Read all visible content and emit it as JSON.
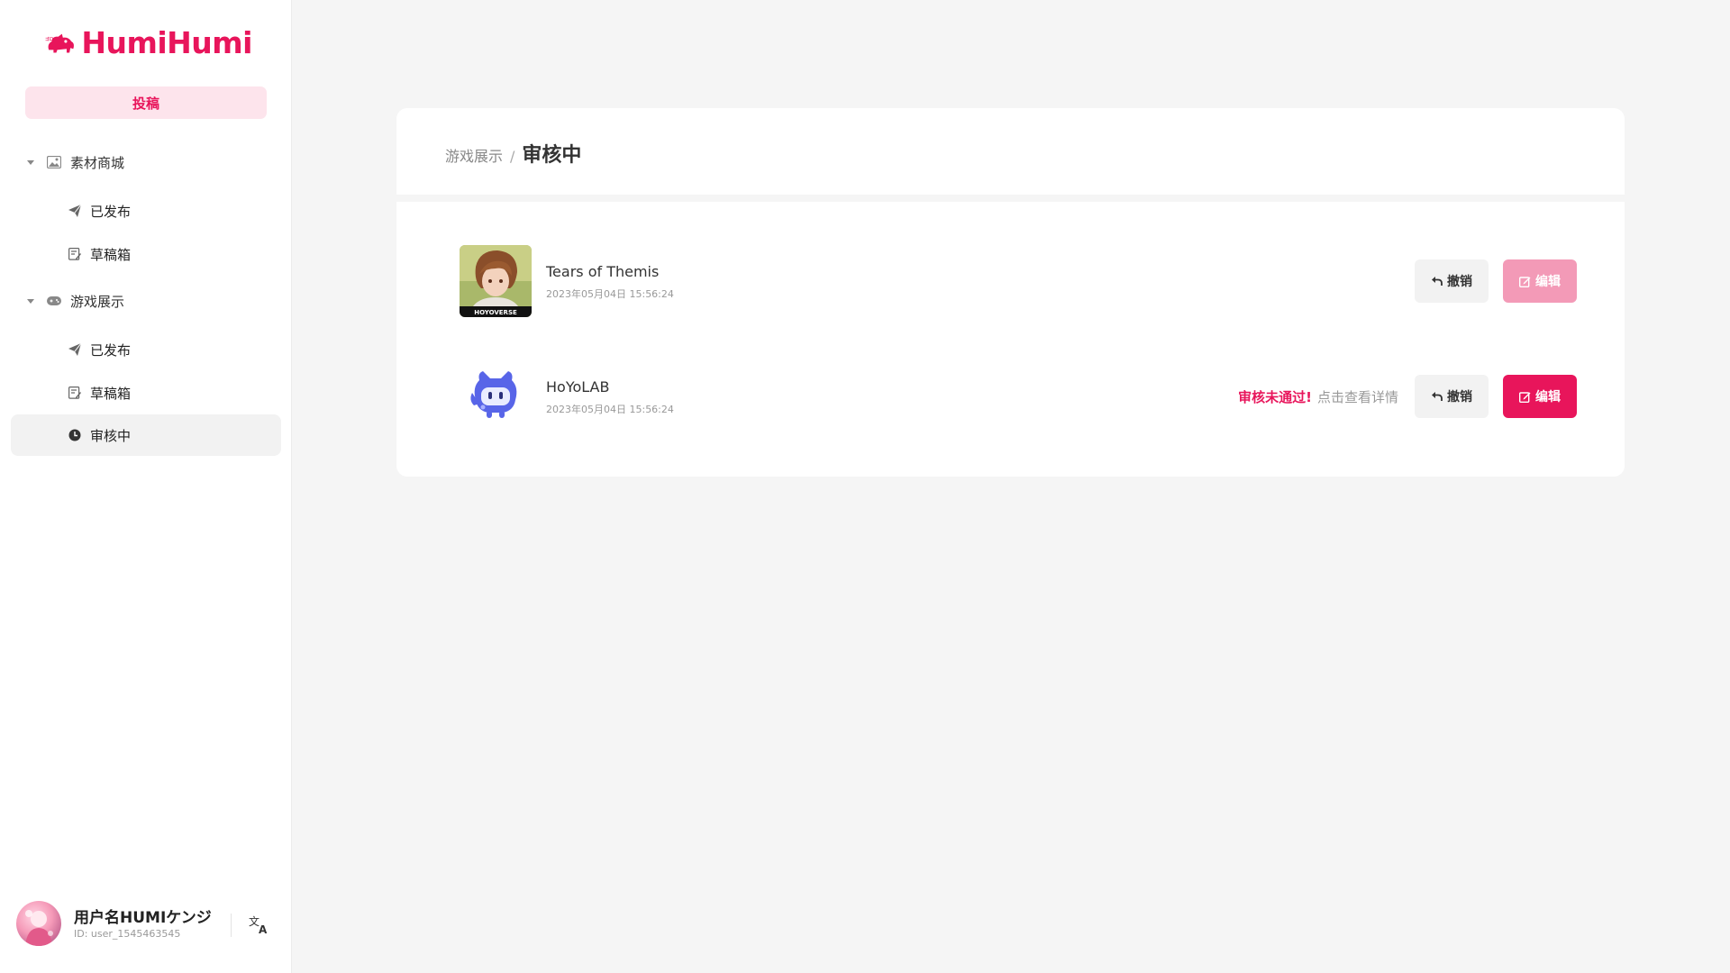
{
  "app": {
    "logo_text": "HumiHumi"
  },
  "sidebar": {
    "submit_label": "投稿",
    "groups": [
      {
        "label": "素材商城",
        "items": [
          {
            "label": "已发布"
          },
          {
            "label": "草稿箱"
          }
        ]
      },
      {
        "label": "游戏展示",
        "items": [
          {
            "label": "已发布"
          },
          {
            "label": "草稿箱"
          },
          {
            "label": "审核中",
            "active": true
          }
        ]
      }
    ]
  },
  "user": {
    "name": "用户名HUMIケンジ",
    "id": "ID: user_1545463545"
  },
  "breadcrumb": {
    "parent": "游戏展示",
    "separator": "/",
    "current": "审核中"
  },
  "items": [
    {
      "title": "Tears of Themis",
      "date": "2023年05月04日 15:56:24",
      "thumb_caption": "HOYOVERSE",
      "revoke_label": "撤销",
      "edit_label": "编辑",
      "edit_disabled": true
    },
    {
      "title": "HoYoLAB",
      "date": "2023年05月04日 15:56:24",
      "status_fail": "审核未通过!",
      "status_link": "点击查看详情",
      "revoke_label": "撤销",
      "edit_label": "编辑",
      "edit_disabled": false
    }
  ],
  "colors": {
    "accent": "#e8155b",
    "accent_light": "#fde4ec",
    "accent_disabled": "#f39ab7"
  },
  "icons": {
    "group1": "image-icon",
    "group2": "gamepad-icon",
    "published": "paper-plane-icon",
    "drafts": "edit-note-icon",
    "reviewing": "clock-icon",
    "revoke": "undo-arrow-icon",
    "edit": "edit-icon",
    "language": "translate-icon"
  }
}
